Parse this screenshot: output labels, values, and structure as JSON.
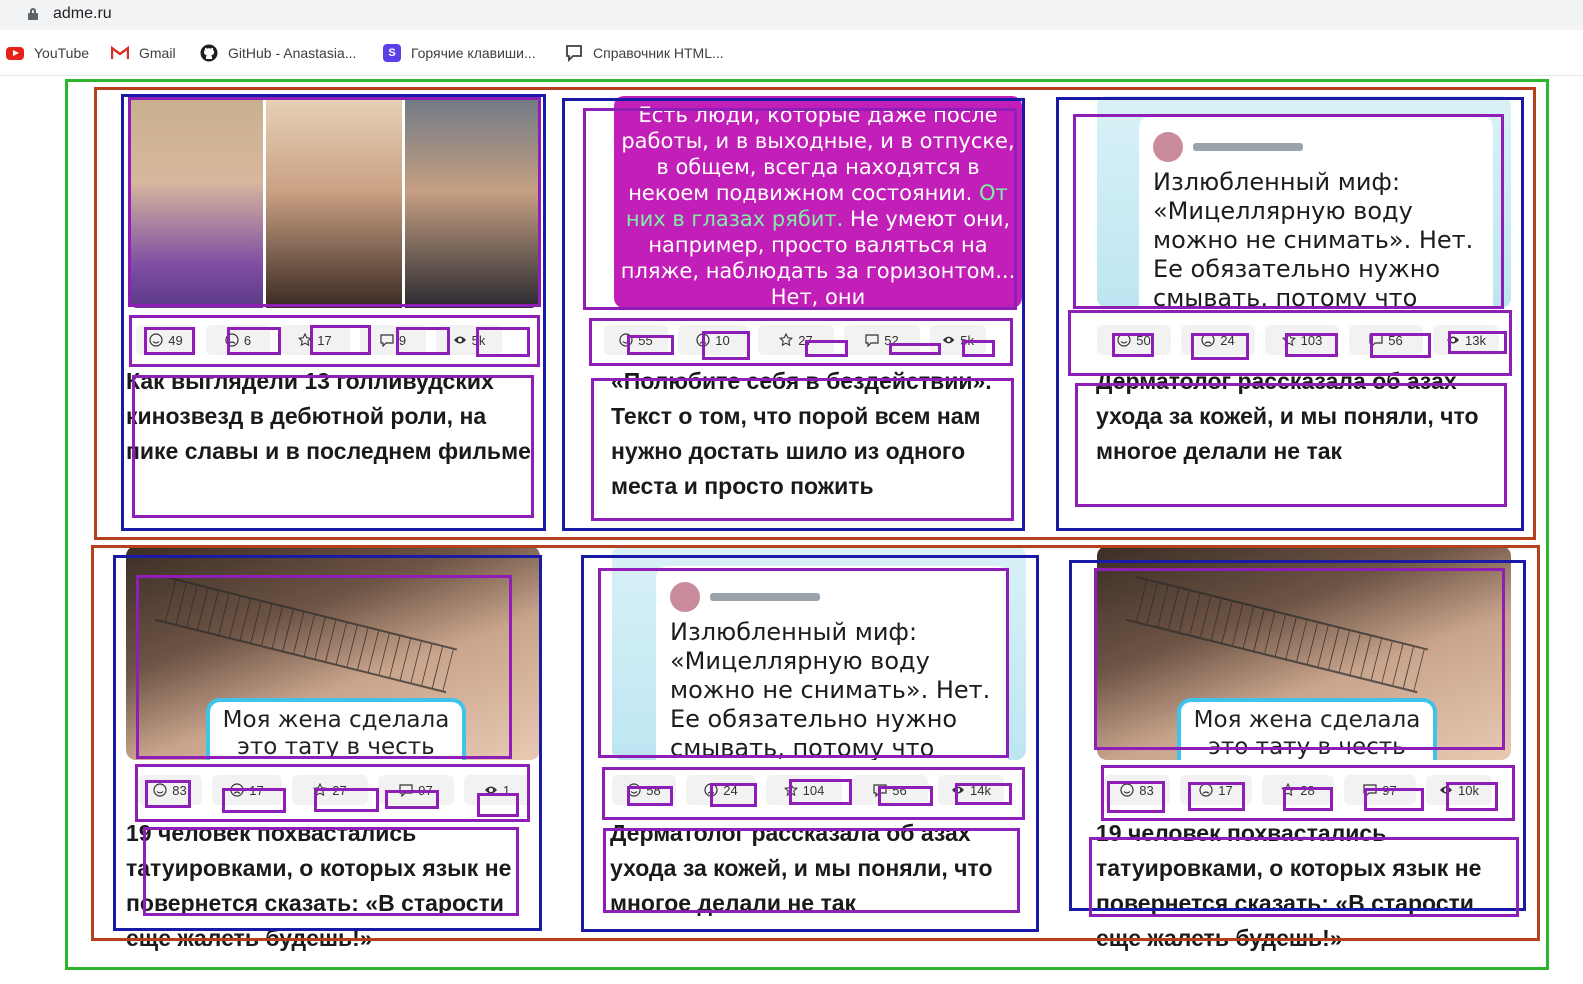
{
  "browser": {
    "url": "adme.ru",
    "bookmarks": [
      {
        "label": "YouTube",
        "icon": "youtube-icon"
      },
      {
        "label": "Gmail",
        "icon": "gmail-icon"
      },
      {
        "label": "GitHub - Anastasia...",
        "icon": "github-icon"
      },
      {
        "label": "Горячие клавиши...",
        "icon": "s-icon"
      },
      {
        "label": "Справочник HTML...",
        "icon": "comment-icon"
      }
    ]
  },
  "cards": [
    {
      "image_kind": "photo-triptych",
      "stats": {
        "smile": "49",
        "sad": "6",
        "star": "17",
        "comment": "9",
        "views": "5k"
      },
      "title": "Как выглядели 13 голливудских кинозвезд в дебютной роли, на пике славы и в последнем фильме"
    },
    {
      "image_kind": "quote-tile",
      "image_text_1": "Есть люди, которые даже после работы, и в выходные, и в отпуске, в общем, всегда находятся в некоем подвижном состоянии.",
      "image_text_accent": "От них в глазах рябит.",
      "image_text_2": "Не умеют они, например, просто валяться на пляже, наблюдать за горизонтом... Нет, они",
      "stats": {
        "smile": "55",
        "sad": "10",
        "star": "27",
        "comment": "52",
        "views": "5k"
      },
      "title": "«Полюбите себя в бездействии». Текст о том, что порой всем нам нужно достать шило из одного места и просто пожить"
    },
    {
      "image_kind": "tweet",
      "image_text": "Излюбленный миф: «Мицеллярную воду можно не снимать». Нет. Ее обязательно нужно смывать, потому что",
      "stats": {
        "smile": "50",
        "sad": "24",
        "star": "103",
        "comment": "56",
        "views": "13k"
      },
      "title": "Дерматолог рассказала об азах ухода за кожей, и мы поняли, что многое делали не так"
    },
    {
      "image_kind": "arm",
      "image_text": "Моя жена сделала это тату в честь",
      "stats": {
        "smile": "83",
        "sad": "17",
        "star": "27",
        "comment": "97",
        "views": "1"
      },
      "title": "19 человек похвастались татуировками, о которых язык не повернется сказать: «В старости еще жалеть будешь!»"
    },
    {
      "image_kind": "tweet",
      "image_text": "Излюбленный миф: «Мицеллярную воду можно не снимать». Нет. Ее обязательно нужно смывать, потому что",
      "stats": {
        "smile": "58",
        "sad": "24",
        "star": "104",
        "comment": "56",
        "views": "14k"
      },
      "title": "Дерматолог рассказала об азах ухода за кожей, и мы поняли, что многое делали не так"
    },
    {
      "image_kind": "arm",
      "image_text": "Моя жена сделала это тату в честь",
      "stats": {
        "smile": "83",
        "sad": "17",
        "star": "28",
        "comment": "97",
        "views": "10k"
      },
      "title": "19 человек похвастались татуировками, о которых язык не повернется сказать: «В старости еще жалеть будешь!»"
    }
  ],
  "colors": {
    "annotation_green": "#2db52d",
    "annotation_orange": "#b5401c",
    "annotation_blue": "#1a1aa6",
    "annotation_purple": "#8e1eb5",
    "quote_tile_bg": "#c21fb8",
    "quote_accent": "#7ef0a4"
  }
}
